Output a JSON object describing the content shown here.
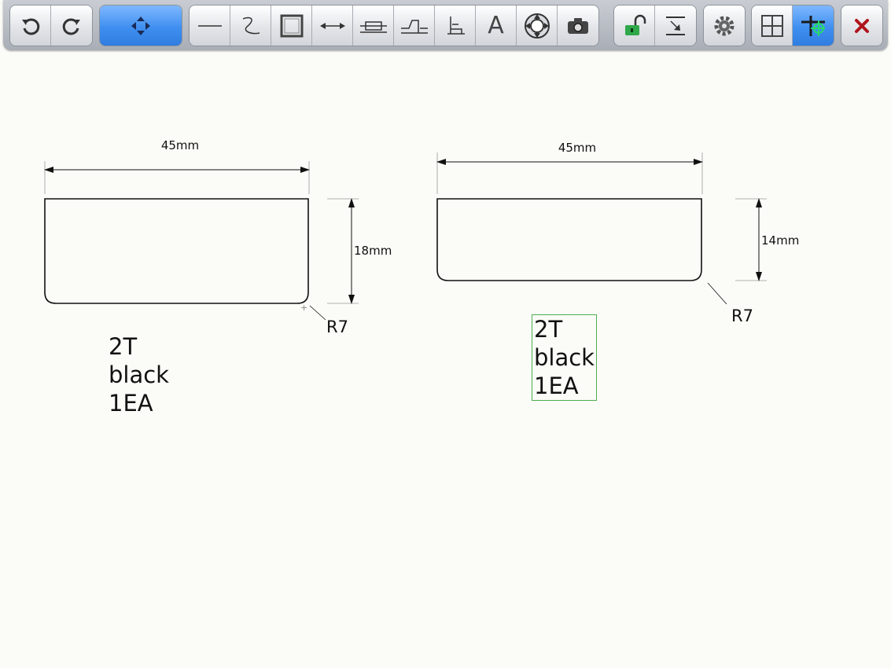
{
  "toolbar": {
    "groups": [
      {
        "buttons": [
          {
            "icon": "undo-icon"
          },
          {
            "icon": "redo-icon"
          }
        ]
      },
      {
        "buttons": [
          {
            "icon": "move-icon",
            "active": true
          }
        ]
      },
      {
        "buttons": [
          {
            "icon": "line-tool-icon"
          },
          {
            "icon": "freehand-tool-icon"
          },
          {
            "icon": "rectangle-tool-icon"
          },
          {
            "icon": "dimension-tool-icon"
          },
          {
            "icon": "fuse-symbol-icon"
          },
          {
            "icon": "step-symbol-icon"
          },
          {
            "icon": "chair-symbol-icon"
          },
          {
            "icon": "text-tool-icon"
          },
          {
            "icon": "target-tool-icon"
          },
          {
            "icon": "camera-icon"
          }
        ]
      },
      {
        "buttons": [
          {
            "icon": "unlock-icon"
          },
          {
            "icon": "import-icon"
          }
        ]
      },
      {
        "buttons": [
          {
            "icon": "gear-icon"
          }
        ]
      },
      {
        "buttons": [
          {
            "icon": "grid-icon"
          },
          {
            "icon": "snap-icon",
            "active": true
          }
        ]
      },
      {
        "buttons": [
          {
            "icon": "close-icon"
          }
        ]
      }
    ],
    "text_tool_glyph": "A"
  },
  "drawing": {
    "left": {
      "width_label": "45mm",
      "height_label": "18mm",
      "radius_label": "R7",
      "note": "2T\nblack\n1EA"
    },
    "right": {
      "width_label": "45mm",
      "height_label": "14mm",
      "radius_label": "R7",
      "note": "2T\nblack\n1EA"
    }
  },
  "colors": {
    "canvas": "#fbfbf7",
    "active_button": "#3f8ff0",
    "selection_outline": "#4caf50",
    "close_x": "#b0151b"
  }
}
